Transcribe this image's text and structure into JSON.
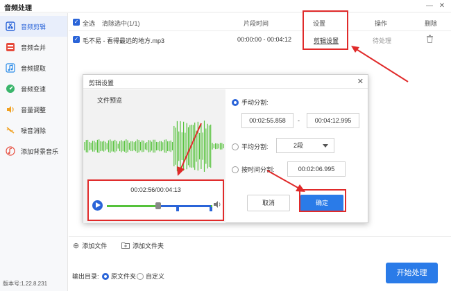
{
  "window": {
    "title": "音频处理"
  },
  "sidebar": {
    "items": [
      {
        "label": "音频剪辑",
        "icon": "scissors-icon",
        "active": true
      },
      {
        "label": "音频合并",
        "icon": "merge-icon"
      },
      {
        "label": "音频提取",
        "icon": "music-note-icon"
      },
      {
        "label": "音频变速",
        "icon": "speed-icon"
      },
      {
        "label": "音量调整",
        "icon": "volume-icon"
      },
      {
        "label": "噪音消除",
        "icon": "noise-icon"
      },
      {
        "label": "添加背景音乐",
        "icon": "music-add-icon"
      }
    ],
    "version": "版本号:1.22.8.231"
  },
  "table": {
    "headers": {
      "select_all": "全选",
      "clear": "清除选中(1/1)",
      "segment_time": "片段时间",
      "settings": "设置",
      "operation": "操作",
      "delete": "删除"
    },
    "rows": [
      {
        "name": "毛不易 - 看得最远的地方.mp3",
        "time": "00:00:00 - 00:04:12",
        "settings_link": "剪辑设置",
        "status": "待处理"
      }
    ]
  },
  "bottom": {
    "add_file": "添加文件",
    "add_folder": "添加文件夹",
    "output_label": "输出目录:",
    "option_original": "原文件夹",
    "option_custom": "自定义",
    "start_button": "开始处理"
  },
  "dialog": {
    "title": "剪辑设置",
    "preview_label": "文件预览",
    "player_time": "00:02:56/00:04:13",
    "manual_split": "手动分割:",
    "manual_start": "00:02:55.858",
    "manual_dash": "-",
    "manual_end": "00:04:12.995",
    "average_split": "平均分割:",
    "average_value": "2段",
    "time_split": "按时间分割:",
    "time_value": "00:02:06.995",
    "cancel": "取消",
    "confirm": "确定"
  },
  "colors": {
    "accent": "#2a64d8",
    "highlight": "#e02a2a",
    "wave": "#55c23b"
  }
}
